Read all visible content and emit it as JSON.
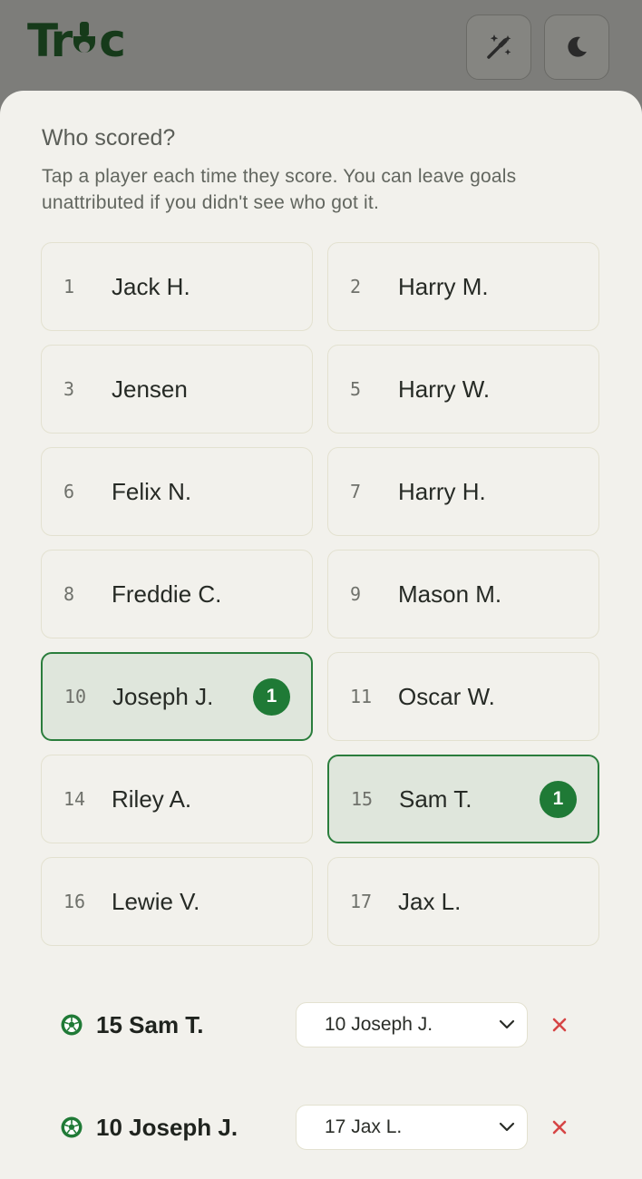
{
  "header": {
    "logo_text_left": "Tr",
    "logo_text_right": "c",
    "magic_icon": "magic-wand-icon",
    "theme_icon": "moon-icon"
  },
  "panel": {
    "title": "Who scored?",
    "description": "Tap a player each time they score. You can leave goals unattributed if you didn't see who got it."
  },
  "players": [
    {
      "number": "1",
      "name": "Jack H.",
      "goals": ""
    },
    {
      "number": "2",
      "name": "Harry M.",
      "goals": ""
    },
    {
      "number": "3",
      "name": "Jensen",
      "goals": ""
    },
    {
      "number": "5",
      "name": "Harry W.",
      "goals": ""
    },
    {
      "number": "6",
      "name": "Felix N.",
      "goals": ""
    },
    {
      "number": "7",
      "name": "Harry H.",
      "goals": ""
    },
    {
      "number": "8",
      "name": "Freddie C.",
      "goals": ""
    },
    {
      "number": "9",
      "name": "Mason M.",
      "goals": ""
    },
    {
      "number": "10",
      "name": "Joseph J.",
      "goals": "1"
    },
    {
      "number": "11",
      "name": "Oscar W.",
      "goals": ""
    },
    {
      "number": "14",
      "name": "Riley A.",
      "goals": ""
    },
    {
      "number": "15",
      "name": "Sam T.",
      "goals": "1"
    },
    {
      "number": "16",
      "name": "Lewie V.",
      "goals": ""
    },
    {
      "number": "17",
      "name": "Jax L.",
      "goals": ""
    }
  ],
  "goals": [
    {
      "scorer": "15 Sam T.",
      "assist_selected": "10 Joseph J."
    },
    {
      "scorer": "10 Joseph J.",
      "assist_selected": "17 Jax L."
    }
  ],
  "colors": {
    "accent_green": "#1f7a36",
    "remove_red": "#d64545"
  }
}
